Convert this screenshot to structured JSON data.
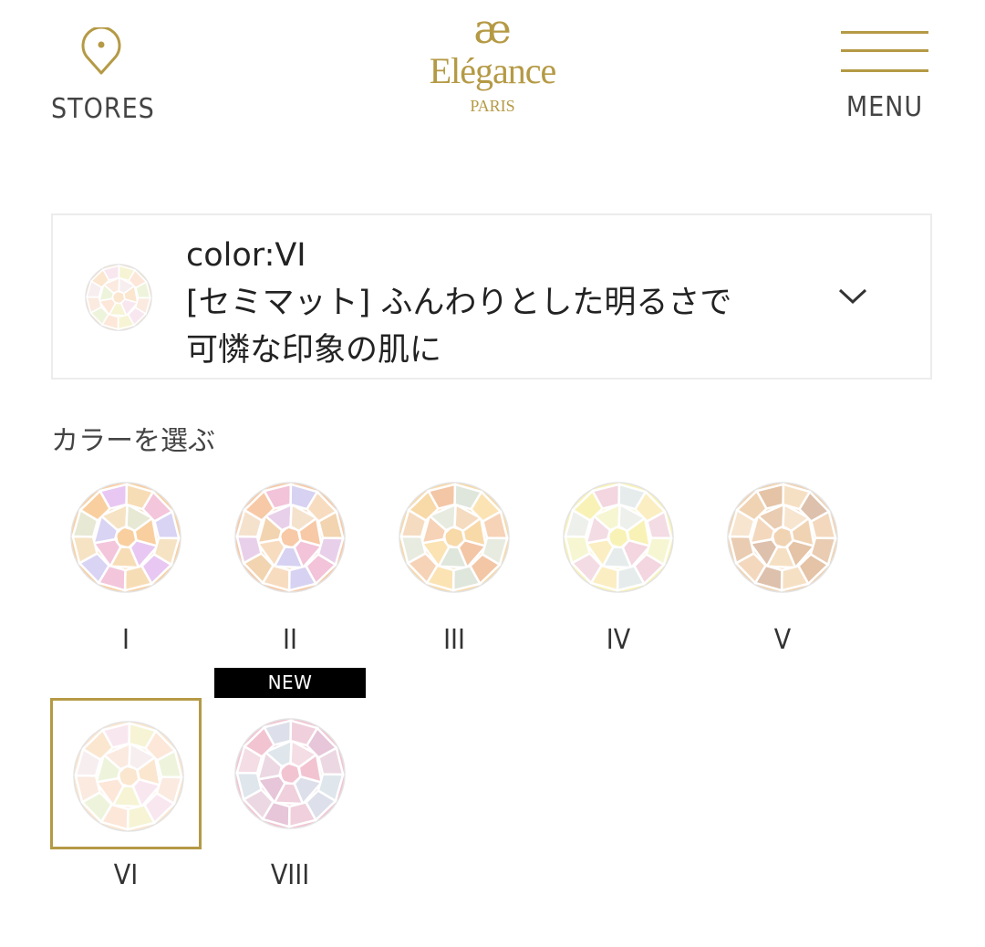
{
  "header": {
    "stores_label": "STORES",
    "stores_icon": "location-pin-icon",
    "logo_monogram": "æ",
    "logo_name": "Elégance",
    "logo_city": "PARIS",
    "menu_label": "MENU",
    "menu_icon": "hamburger-icon",
    "accent_color": "#b59a45"
  },
  "selector": {
    "color_line": "color:VI",
    "desc_line1": "[セミマット] ふんわりとした明るさで",
    "desc_line2": "可憐な印象の肌に",
    "dropdown_icon": "chevron-down-icon"
  },
  "section_title": "カラーを選ぶ",
  "swatches": [
    {
      "label": "I",
      "colors": [
        "#f9cfa0",
        "#e8c8f3",
        "#f7ddb6",
        "#f3c6dc",
        "#d9d3f4",
        "#f6e3c4",
        "#e7e9d4"
      ],
      "selected": false
    },
    {
      "label": "II",
      "colors": [
        "#f7c9a6",
        "#f2c3d9",
        "#d7d2f1",
        "#f8dcc0",
        "#f2d4b0",
        "#e9d0ea",
        "#f5e2cd"
      ],
      "selected": false
    },
    {
      "label": "III",
      "colors": [
        "#f8d9a8",
        "#f3c6a6",
        "#dfe6dc",
        "#fbe3b4",
        "#f6d2b7",
        "#e8ebe0",
        "#f5dcc0"
      ],
      "selected": false
    },
    {
      "label": "IV",
      "colors": [
        "#f9f2b6",
        "#f3d6df",
        "#e6ecec",
        "#fbeec2",
        "#f4dce4",
        "#f6f6d2",
        "#eef0ec"
      ],
      "selected": false
    },
    {
      "label": "V",
      "colors": [
        "#f0d3b3",
        "#e4c3a6",
        "#f6e0c4",
        "#ddc1ad",
        "#f3d8bd",
        "#e9ccb1",
        "#f7e5cf"
      ],
      "selected": false
    },
    {
      "label": "VI",
      "colors": [
        "#fbe6cf",
        "#f9e7f0",
        "#f6f4d4",
        "#fde7d9",
        "#eef4dc",
        "#fbeae0",
        "#f7eef0"
      ],
      "selected": true,
      "badge": ""
    },
    {
      "label": "VIII",
      "colors": [
        "#f2c4d2",
        "#dde0ea",
        "#f0d0dc",
        "#e6c6d8",
        "#ecd8e2",
        "#dfe6ec",
        "#f4dde4"
      ],
      "selected": false,
      "badge": "NEW"
    }
  ]
}
